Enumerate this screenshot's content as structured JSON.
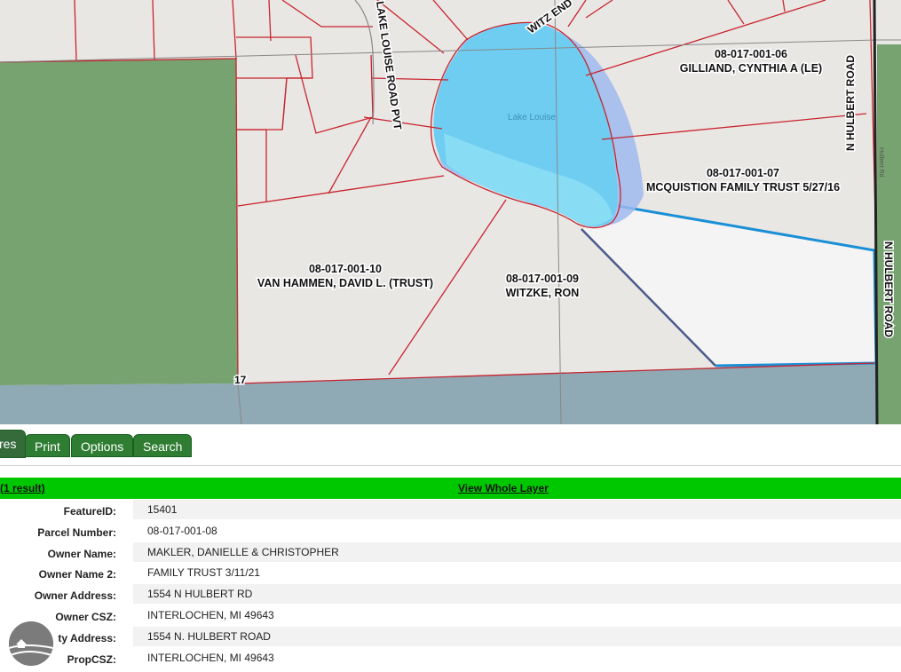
{
  "map": {
    "water_label": "Lake Louise",
    "parcels": [
      {
        "id": "08-017-001-06",
        "owner": "GILLIAND, CYNTHIA A (LE)"
      },
      {
        "id": "08-017-001-07",
        "owner": "MCQUISTION FAMILY TRUST 5/27/16"
      },
      {
        "id": "08-017-001-10",
        "owner": "VAN HAMMEN, DAVID L. (TRUST)"
      },
      {
        "id": "08-017-001-09",
        "owner": "WITZKE, RON"
      }
    ],
    "roads": {
      "lake_louise": "LAKE LOUISE ROAD PVT",
      "witz_end": "WITZ END",
      "n_hulbert": "N HULBERT ROAD",
      "hulbert_rd_small": "Hulbert Rd"
    },
    "section_number": "17",
    "colors": {
      "background": "#e9e7e4",
      "forest": "#76a36f",
      "water": "#6fcdf2",
      "selected_outline": "#1a8fd6",
      "parcel_lines": "#c8242e",
      "bottom_band": "#8fa9b5"
    }
  },
  "tabs": [
    {
      "label": "res",
      "active": true
    },
    {
      "label": "Print",
      "active": false
    },
    {
      "label": "Options",
      "active": false
    },
    {
      "label": "Search",
      "active": false
    }
  ],
  "results": {
    "count_text": "(1 result)",
    "view_whole_layer": "View Whole Layer",
    "bar_color": "#00c800"
  },
  "attributes": [
    {
      "key": "FeatureID:",
      "value": "15401"
    },
    {
      "key": "Parcel Number:",
      "value": "08-017-001-08"
    },
    {
      "key": "Owner Name:",
      "value": "MAKLER, DANIELLE & CHRISTOPHER"
    },
    {
      "key": "Owner Name 2:",
      "value": "FAMILY TRUST 3/11/21"
    },
    {
      "key": "Owner Address:",
      "value": "1554 N HULBERT RD"
    },
    {
      "key": "Owner CSZ:",
      "value": "INTERLOCHEN, MI 49643"
    },
    {
      "key": "ty Address:",
      "value": "1554 N. HULBERT ROAD"
    },
    {
      "key": "PropCSZ:",
      "value": "INTERLOCHEN, MI 49643"
    }
  ],
  "logo_icon": "land-conservancy-logo-icon"
}
